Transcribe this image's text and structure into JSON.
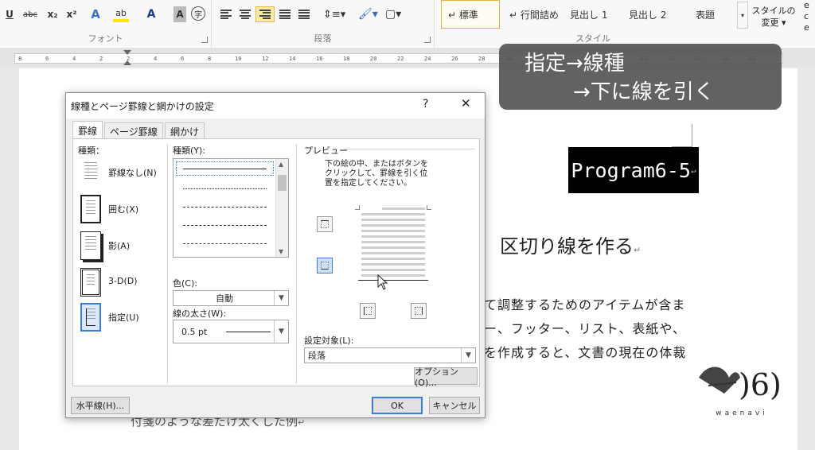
{
  "ribbon": {
    "font_group_label": "フォント",
    "paragraph_group_label": "段落",
    "styles_group_label": "スタイル",
    "font_buttons": [
      "U",
      "abc",
      "x₂",
      "x²",
      "A",
      "ab",
      "A",
      "A",
      "字"
    ],
    "styles": [
      "↵ 標準",
      "↵ 行間詰め",
      "見出し 1",
      "見出し 2",
      "表題"
    ],
    "change_styles": [
      "スタイルの",
      "変更 ▾"
    ],
    "more": "▾",
    "side_letters": [
      "e",
      "c",
      "e"
    ]
  },
  "ruler": {
    "ticks": [
      "8",
      "6",
      "4",
      "2",
      "2",
      "4",
      "6",
      "8",
      "10",
      "12",
      "14",
      "16",
      "18",
      "20",
      "22",
      "24",
      "26",
      "28",
      "30",
      "32",
      "34",
      "36",
      "38",
      "40",
      "42",
      "44",
      "46",
      "48"
    ]
  },
  "note": {
    "line1": "指定→線種",
    "line2": "→下に線を引く"
  },
  "document": {
    "program_label": "Program6-5",
    "para_mark": "↵",
    "heading": "区切り線を作る",
    "lines": [
      "て調整するためのアイテムが含ま",
      "ー、フッター、リスト、表紙や、",
      "を作成すると、文書の現在の体裁"
    ],
    "bottom_line": "付箋のような差だけ太くした例"
  },
  "dialog": {
    "title": "線種とページ罫線と網かけの設定",
    "help": "?",
    "close": "✕",
    "tabs": [
      "罫線",
      "ページ罫線",
      "網かけ"
    ],
    "setting_label": "種類：",
    "settings": [
      {
        "label": "罫線なし(N)"
      },
      {
        "label": "囲む(X)"
      },
      {
        "label": "影(A)"
      },
      {
        "label": "3-D(D)"
      },
      {
        "label": "指定(U)"
      }
    ],
    "style_label": "種類(Y):",
    "color_label": "色(C):",
    "color_value": "自動",
    "width_label": "線の太さ(W):",
    "width_value": "0.5 pt",
    "preview_label": "プレビュー",
    "preview_hint": [
      "下の絵の中、またはボタンを",
      "クリックして、罫線を引く位",
      "置を指定してください。"
    ],
    "apply_label": "設定対象(L):",
    "apply_value": "段落",
    "options_button": "オプション(O)...",
    "horizontal_line_button": "水平線(H)...",
    "ok_button": "OK",
    "cancel_button": "キャンセル"
  },
  "logo_text": "waenavi"
}
